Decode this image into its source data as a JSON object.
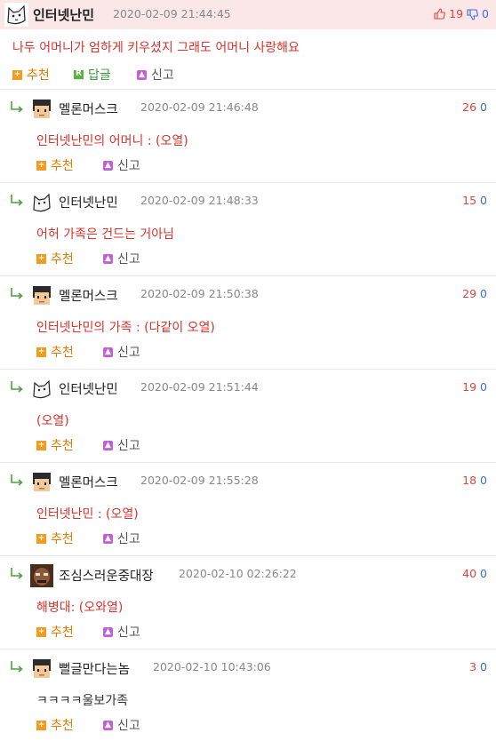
{
  "top": {
    "author": "인터넷난민",
    "date": "2020-02-09 21:44:45",
    "up": "19",
    "down": "0",
    "text": "나두 어머니가 엄하게 키우셨지 그래도 어머니 사랑해요",
    "actions": {
      "recommend": "추천",
      "reply_badge": "R",
      "reply": "답글",
      "report": "신고"
    }
  },
  "replies": [
    {
      "author": "멜론머스크",
      "avatar": "pixel-face",
      "date": "2020-02-09 21:46:48",
      "up": "26",
      "down": "0",
      "text": "인터넷난민의 어머니 : (오열)"
    },
    {
      "author": "인터넷난민",
      "avatar": "cat",
      "date": "2020-02-09 21:48:33",
      "up": "15",
      "down": "0",
      "text": "어허 가족은 건드는 거아님"
    },
    {
      "author": "멜론머스크",
      "avatar": "pixel-face",
      "date": "2020-02-09 21:50:38",
      "up": "29",
      "down": "0",
      "text": "인터넷난민의 가족 : (다같이 오열)"
    },
    {
      "author": "인터넷난민",
      "avatar": "cat",
      "date": "2020-02-09 21:51:44",
      "up": "19",
      "down": "0",
      "text": "(오열)"
    },
    {
      "author": "멜론머스크",
      "avatar": "pixel-face",
      "date": "2020-02-09 21:55:28",
      "up": "18",
      "down": "0",
      "text": "인터넷난민 : (오열)"
    },
    {
      "author": "조심스러운중대장",
      "avatar": "brown-face",
      "date": "2020-02-10 02:26:22",
      "up": "40",
      "down": "0",
      "text": "해병대: (오와열)"
    },
    {
      "author": "뻘글만다는놈",
      "avatar": "pixel-face",
      "date": "2020-02-10 10:43:06",
      "up": "3",
      "down": "0",
      "text": "ㅋㅋㅋㅋ울보가족"
    }
  ],
  "reply_actions": {
    "recommend": "추천",
    "report": "신고"
  },
  "colors": {
    "accent_red": "#d9312a",
    "header_bg": "#fbe7e7",
    "recommend": "#f29b1e",
    "reply_green": "#5bb140",
    "down_blue": "#3a6fd8"
  }
}
